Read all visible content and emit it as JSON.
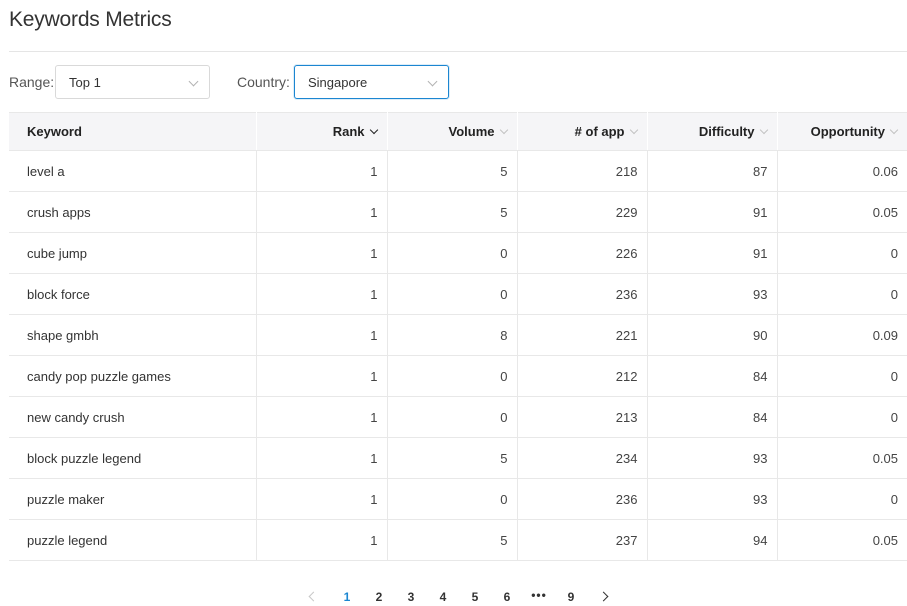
{
  "page": {
    "title": "Keywords Metrics"
  },
  "filters": {
    "range_label": "Range:",
    "range_value": "Top 1",
    "country_label": "Country:",
    "country_value": "Singapore"
  },
  "table": {
    "columns": [
      "Keyword",
      "Rank",
      "Volume",
      "# of app",
      "Difficulty",
      "Opportunity"
    ],
    "sorted_column": "Rank",
    "rows": [
      [
        "level a",
        "1",
        "5",
        "218",
        "87",
        "0.06"
      ],
      [
        "crush apps",
        "1",
        "5",
        "229",
        "91",
        "0.05"
      ],
      [
        "cube jump",
        "1",
        "0",
        "226",
        "91",
        "0"
      ],
      [
        "block force",
        "1",
        "0",
        "236",
        "93",
        "0"
      ],
      [
        "shape gmbh",
        "1",
        "8",
        "221",
        "90",
        "0.09"
      ],
      [
        "candy pop puzzle games",
        "1",
        "0",
        "212",
        "84",
        "0"
      ],
      [
        "new candy crush",
        "1",
        "0",
        "213",
        "84",
        "0"
      ],
      [
        "block puzzle legend",
        "1",
        "5",
        "234",
        "93",
        "0.05"
      ],
      [
        "puzzle maker",
        "1",
        "0",
        "236",
        "93",
        "0"
      ],
      [
        "puzzle legend",
        "1",
        "5",
        "237",
        "94",
        "0.05"
      ]
    ]
  },
  "pagination": {
    "pages": [
      "1",
      "2",
      "3",
      "4",
      "5",
      "6"
    ],
    "ellipsis": "•••",
    "last_page": "9",
    "current_page": "1",
    "prev_icon": "chevron-left-icon",
    "next_icon": "chevron-right-icon"
  },
  "colors": {
    "accent": "#1b86d1",
    "header_bg": "#f5f5f7",
    "border": "#e8e8e8"
  }
}
